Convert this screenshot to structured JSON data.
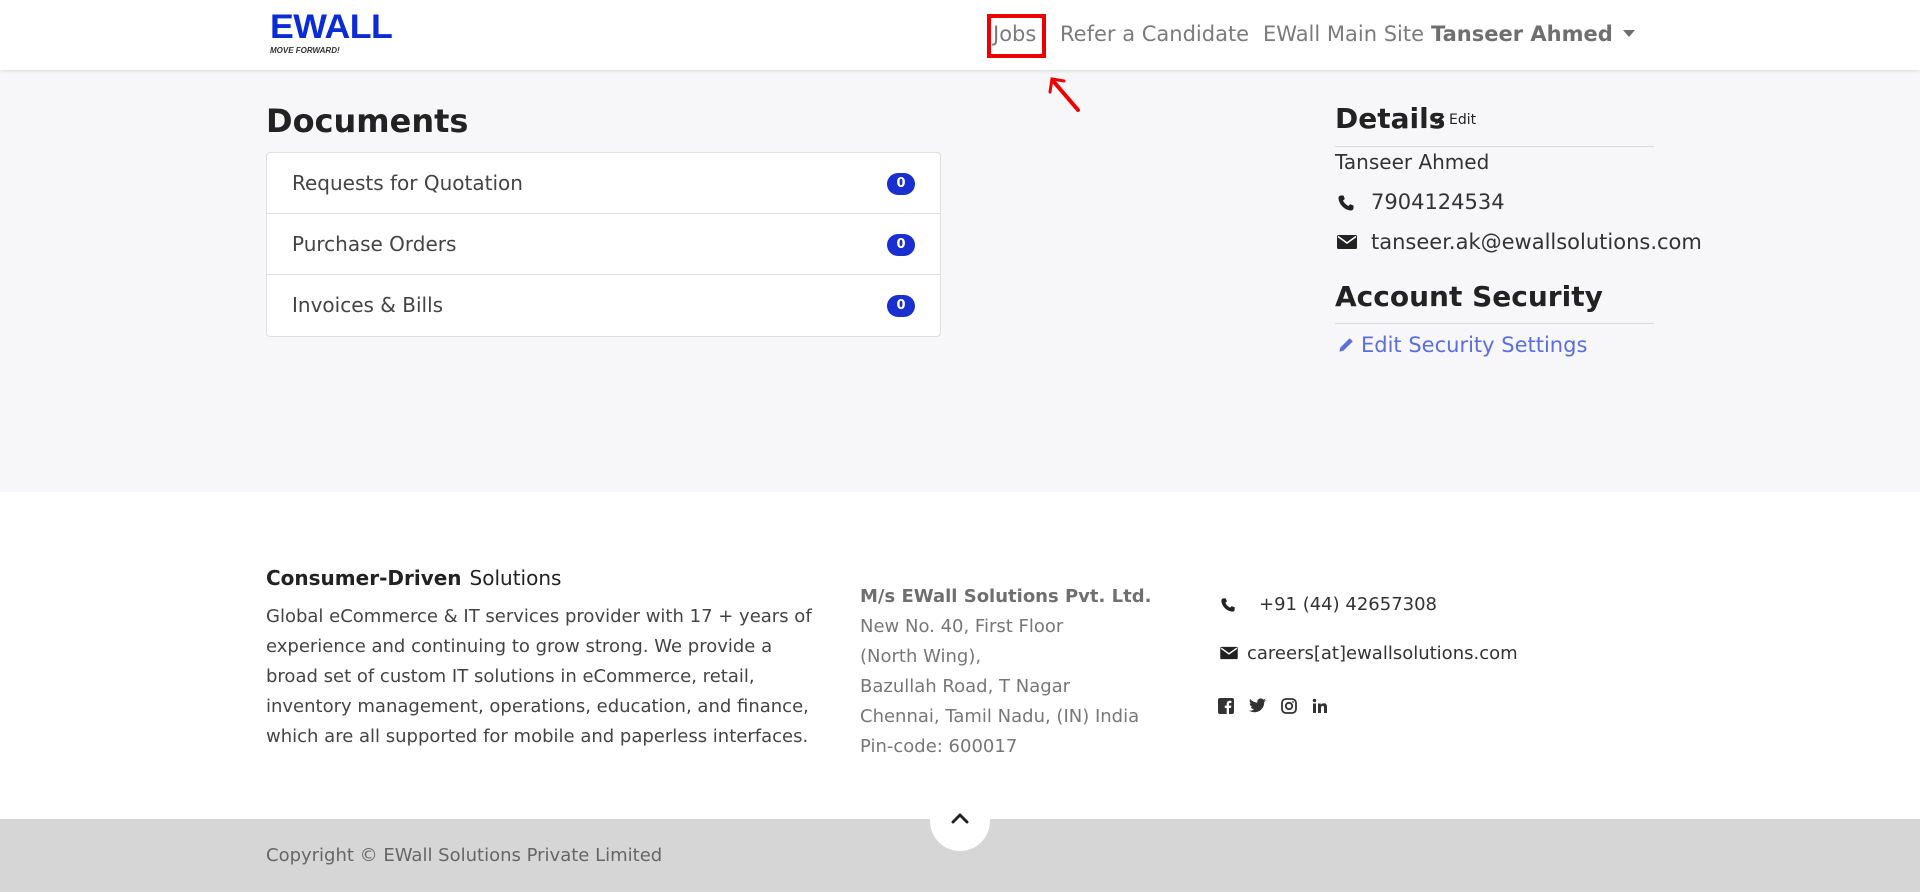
{
  "brand": {
    "name": "EWALL",
    "tagline": "MOVE FORWARD!"
  },
  "nav": {
    "jobs": "Jobs",
    "refer": "Refer a Candidate",
    "main_site": "EWall Main Site",
    "user": "Tanseer Ahmed"
  },
  "documents": {
    "title": "Documents",
    "items": [
      {
        "label": "Requests for Quotation",
        "count": "0"
      },
      {
        "label": "Purchase Orders",
        "count": "0"
      },
      {
        "label": "Invoices & Bills",
        "count": "0"
      }
    ]
  },
  "details": {
    "title": "Details",
    "edit": "Edit",
    "name": "Tanseer Ahmed",
    "phone": "7904124534",
    "email": "tanseer.ak@ewallsolutions.com"
  },
  "security": {
    "title": "Account Security",
    "link": "Edit Security Settings"
  },
  "footer": {
    "heading_bold": "Consumer-Driven",
    "heading_rest": "Solutions",
    "description": "Global eCommerce & IT services provider with 17 + years of experience and continuing to grow strong. We provide a broad set of custom IT solutions in eCommerce, retail, inventory management, operations, education, and finance, which are all supported for mobile and paperless interfaces.",
    "address": {
      "company": "M/s EWall Solutions Pvt. Ltd.",
      "line1": "New No. 40, First Floor",
      "line2": "(North Wing),",
      "line3": "Bazullah Road, T Nagar",
      "line4": "Chennai, Tamil Nadu, (IN) India",
      "line5": "Pin-code: 600017"
    },
    "phone": "+91 (44) 42657308",
    "email": "careers[at]ewallsolutions.com",
    "social_icons": [
      "facebook-icon",
      "twitter-icon",
      "instagram-icon",
      "linkedin-icon"
    ],
    "copyright": "Copyright © EWall Solutions Private Limited"
  },
  "colors": {
    "brand_blue": "#0b2bd6",
    "badge_blue": "#1a2fcf",
    "link_blue": "#5a6ee0",
    "highlight_red": "#ee0000"
  }
}
